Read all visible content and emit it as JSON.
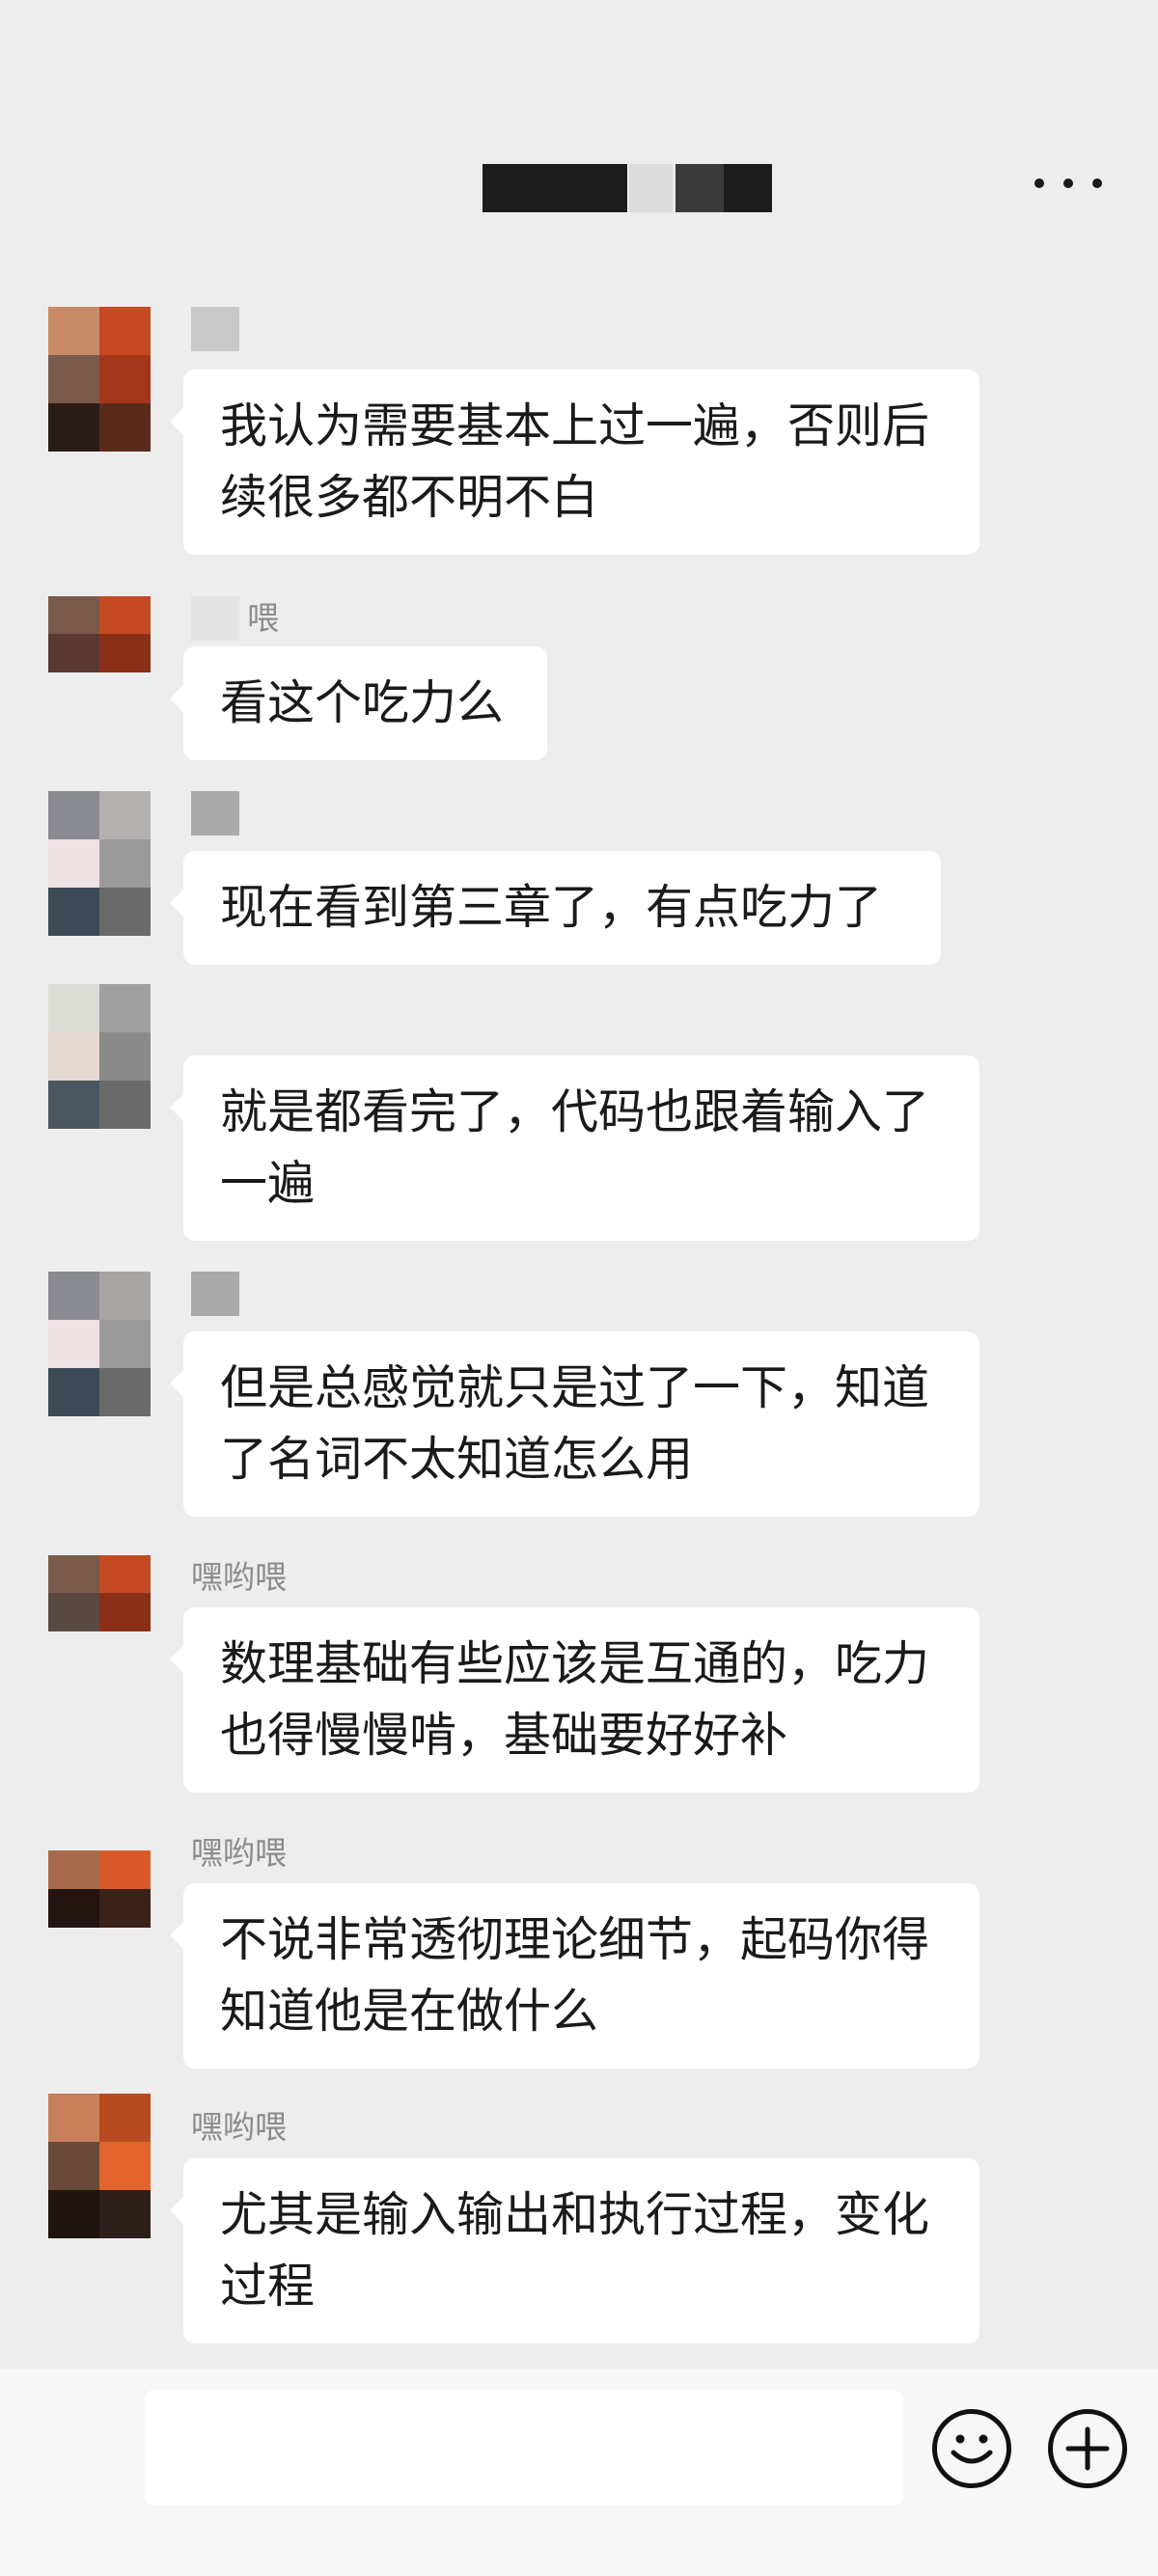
{
  "header": {
    "title_redacted": "",
    "more_label": "···"
  },
  "messages": [
    {
      "sender": "",
      "text": "我认为需要基本上过一遍，否则后续很多都不明不白"
    },
    {
      "sender": "喂",
      "text": "看这个吃力么"
    },
    {
      "sender": "",
      "text": "现在看到第三章了，有点吃力了"
    },
    {
      "sender": "",
      "text": "就是都看完了，代码也跟着输入了一遍"
    },
    {
      "sender": "",
      "text": "但是总感觉就只是过了一下，知道了名词不太知道怎么用"
    },
    {
      "sender": "嘿哟喂",
      "text": "数理基础有些应该是互通的，吃力也得慢慢啃，基础要好好补"
    },
    {
      "sender": "嘿哟喂",
      "text": "不说非常透彻理论细节，起码你得知道他是在做什么"
    },
    {
      "sender": "嘿哟喂",
      "text": "尤其是输入输出和执行过程，变化过程"
    }
  ],
  "input": {
    "placeholder": "",
    "emoji_icon": "emoji-icon",
    "plus_icon": "plus-icon"
  },
  "colors": {
    "background": "#ededed",
    "bubble": "#ffffff",
    "text": "#1a1a1a",
    "sender": "#8c8c8c"
  }
}
